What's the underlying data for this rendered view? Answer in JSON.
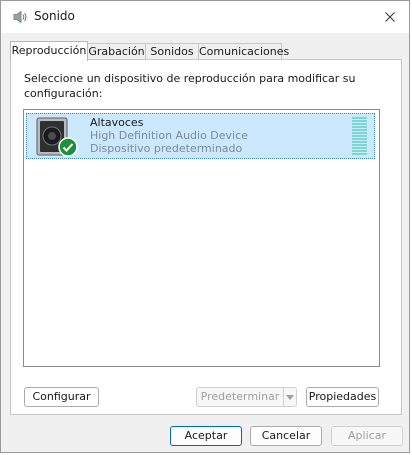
{
  "window": {
    "title": "Sonido"
  },
  "tabs": [
    {
      "label": "Reproducción",
      "active": true
    },
    {
      "label": "Grabación",
      "active": false
    },
    {
      "label": "Sonidos",
      "active": false
    },
    {
      "label": "Comunicaciones",
      "active": false
    }
  ],
  "playback": {
    "instructions": "Seleccione un dispositivo de reproducción para modificar su configuración:",
    "devices": [
      {
        "name": "Altavoces",
        "description": "High Definition Audio Device",
        "status": "Dispositivo predeterminado",
        "icon": "speaker-icon",
        "badge": "default-device-check-icon",
        "selected": true
      }
    ],
    "buttons": {
      "configure": "Configurar",
      "set_default": "Predeterminar",
      "properties": "Propiedades"
    }
  },
  "dialog_buttons": {
    "ok": "Aceptar",
    "cancel": "Cancelar",
    "apply": "Aplicar"
  },
  "colors": {
    "selection": "#cce8ff",
    "accent": "#0067c0",
    "check_badge": "#1f8f3c",
    "level_meter": "#7fd6d0"
  }
}
